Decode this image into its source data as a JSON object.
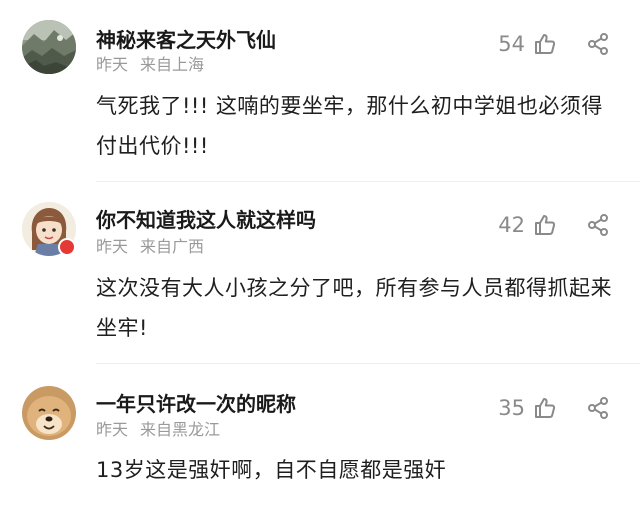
{
  "comments": [
    {
      "username": "神秘来客之天外飞仙",
      "time": "昨天",
      "location": "来自上海",
      "likes": "54",
      "text": "气死我了!!! 这喃的要坐牢，那什么初中学姐也必须得付出代价!!!",
      "avatar_icon": "landscape-photo-avatar"
    },
    {
      "username": "你不知道我这人就这样吗",
      "time": "昨天",
      "location": "来自广西",
      "likes": "42",
      "text": "这次没有大人小孩之分了吧，所有参与人员都得抓起来坐牢!",
      "avatar_icon": "cartoon-girl-avatar"
    },
    {
      "username": "一年只许改一次的昵称",
      "time": "昨天",
      "location": "来自黑龙江",
      "likes": "35",
      "text": "13岁这是强奸啊，自不自愿都是强奸",
      "avatar_icon": "dog-avatar"
    }
  ],
  "colors": {
    "username": "#1a1a1a",
    "meta": "#9a9a9a",
    "icon": "#8a8a8a",
    "badge": "#e53935"
  }
}
